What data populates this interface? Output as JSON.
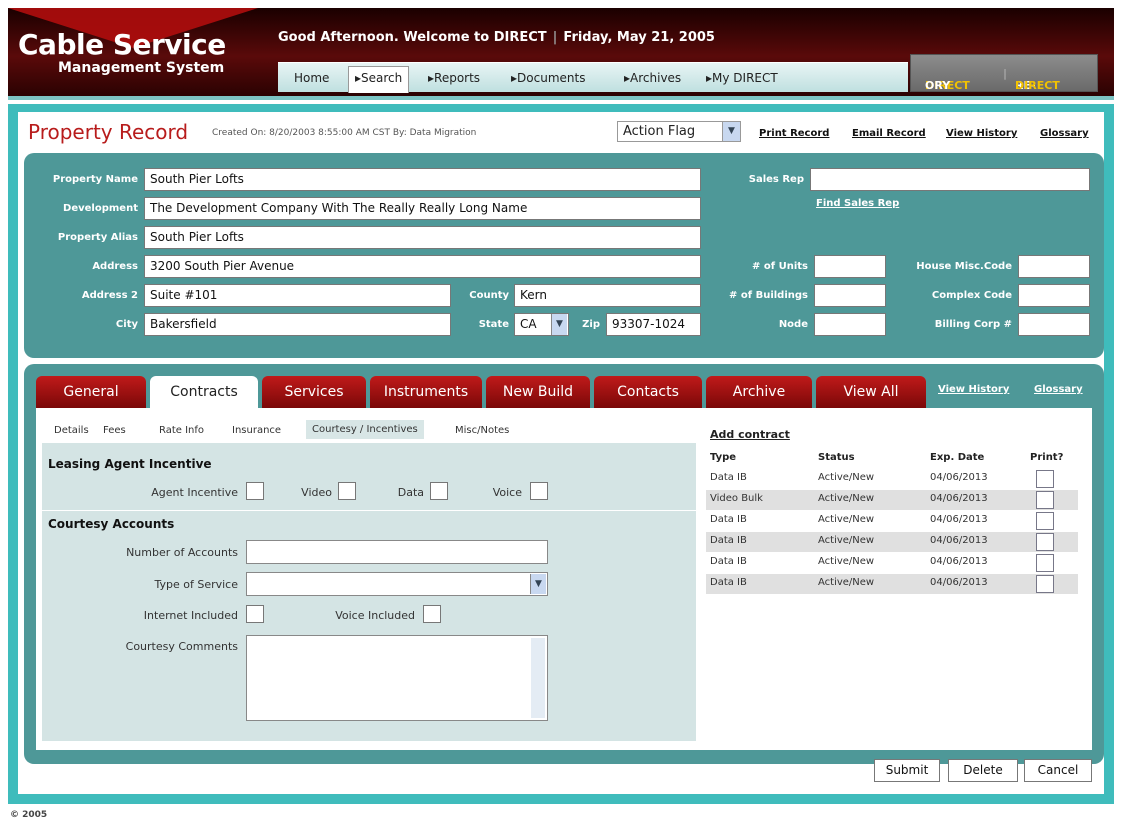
{
  "app": {
    "title_line1": "Cable Service",
    "title_line2": "Management System"
  },
  "header": {
    "greeting": "Good Afternoon. Welcome to DIRECT",
    "date": "Friday, May 21, 2005"
  },
  "nav": {
    "home": "Home",
    "search": "Search",
    "reports": "Reports",
    "documents": "Documents",
    "archives": "Archives",
    "my_direct": "My DIRECT"
  },
  "directory": {
    "dir1": "DIRECT",
    "dir2": "ORY",
    "redir1": "RE-",
    "redir2": "DIRECT"
  },
  "record": {
    "title": "Property Record",
    "created": "Created On: 8/20/2003 8:55:00 AM CST  By: Data Migration",
    "action_flag": "Action Flag",
    "links": {
      "print": "Print Record",
      "email": "Email Record",
      "history": "View History",
      "glossary": "Glossary"
    }
  },
  "property": {
    "labels": {
      "name": "Property Name",
      "development": "Development",
      "alias": "Property Alias",
      "address": "Address",
      "address2": "Address 2",
      "city": "City",
      "county": "County",
      "state": "State",
      "zip": "Zip",
      "sales_rep": "Sales Rep",
      "units": "# of Units",
      "buildings": "# of Buildings",
      "node": "Node",
      "house_misc": "House Misc.Code",
      "complex": "Complex Code",
      "billing": "Billing Corp #"
    },
    "values": {
      "name": "South Pier Lofts",
      "development": "The Development Company With The Really Really Long Name",
      "alias": "South Pier Lofts",
      "address": "3200 South Pier Avenue",
      "address2": "Suite #101",
      "city": "Bakersfield",
      "county": "Kern",
      "state": "CA",
      "zip": "93307-1024",
      "sales_rep": "",
      "units": "",
      "buildings": "",
      "node": "",
      "house_misc": "",
      "complex": "",
      "billing": ""
    },
    "find_sales_rep": "Find Sales Rep"
  },
  "tabs": [
    "General",
    "Contracts",
    "Services",
    "Instruments",
    "New Build",
    "Contacts",
    "Archive",
    "View All"
  ],
  "tab_links": {
    "history": "View History",
    "glossary": "Glossary"
  },
  "subtabs": [
    "Details",
    "Fees",
    "Rate Info",
    "Insurance",
    "Courtesy / Incentives",
    "Misc/Notes"
  ],
  "leasing": {
    "header": "Leasing Agent Incentive",
    "agent": "Agent Incentive",
    "video": "Video",
    "data": "Data",
    "voice": "Voice"
  },
  "courtesy": {
    "header": "Courtesy Accounts",
    "num_accounts": "Number of Accounts",
    "type_service": "Type of Service",
    "internet": "Internet Included",
    "voice": "Voice Included",
    "comments": "Courtesy Comments"
  },
  "contracts": {
    "add": "Add contract",
    "headers": {
      "type": "Type",
      "status": "Status",
      "exp": "Exp. Date",
      "print": "Print?"
    },
    "rows": [
      {
        "type": "Data IB",
        "status": "Active/New",
        "exp": "04/06/2013"
      },
      {
        "type": "Video Bulk",
        "status": "Active/New",
        "exp": "04/06/2013"
      },
      {
        "type": "Data IB",
        "status": "Active/New",
        "exp": "04/06/2013"
      },
      {
        "type": "Data IB",
        "status": "Active/New",
        "exp": "04/06/2013"
      },
      {
        "type": "Data IB",
        "status": "Active/New",
        "exp": "04/06/2013"
      },
      {
        "type": "Data IB",
        "status": "Active/New",
        "exp": "04/06/2013"
      }
    ]
  },
  "buttons": {
    "submit": "Submit",
    "delete": "Delete",
    "cancel": "Cancel"
  },
  "footer": {
    "copyright": "© 2005"
  },
  "colors": {
    "brand_red": "#b81c1c",
    "teal": "#3fbcbc",
    "panel": "#4e9898",
    "directory_yellow": "#f2c200"
  }
}
